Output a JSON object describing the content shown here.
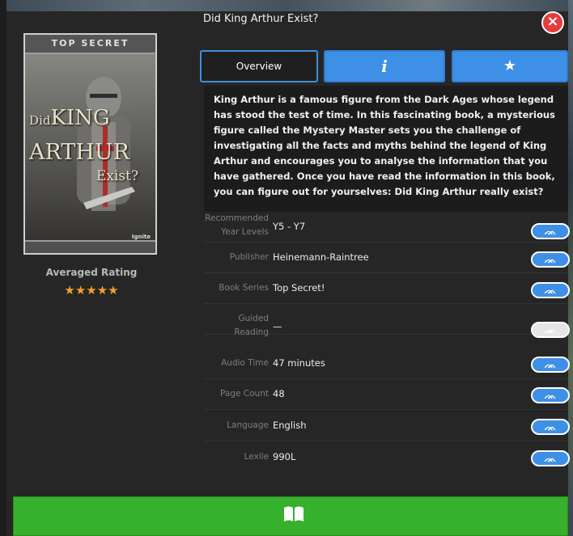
{
  "book": {
    "title": "Did King Arthur Exist?",
    "cover": {
      "series_banner": "TOP SECRET",
      "title_line1_prefix": "Did",
      "title_line1": "KING",
      "title_line2": "ARTHUR",
      "title_line3": "Exist?",
      "publisher_mark": "Ignite"
    },
    "rating_label": "Averaged Rating",
    "rating_stars": 5,
    "stars_text": "★★★★★"
  },
  "tabs": {
    "overview_label": "Overview",
    "info_icon": "i",
    "star_icon": "★"
  },
  "close_icon": "×",
  "description": "King Arthur is a famous figure from the Dark Ages whose legend has stood the test of time. In this fascinating book, a mysterious figure called the Mystery Master sets you the challenge of investigating all the facts and myths behind the legend of King Arthur and encourages you to analyse the information that you have gathered. Once you have read the information in this book, you can figure out for yourselves: Did King Arthur really exist?",
  "metadata": [
    {
      "label_line1": "Recommended",
      "label_line2": "Year Levels",
      "value": "Y5 - Y7",
      "button_enabled": true
    },
    {
      "label_line1": "Publisher",
      "label_line2": "",
      "value": "Heinemann-Raintree",
      "button_enabled": true
    },
    {
      "label_line1": "Book Series",
      "label_line2": "",
      "value": "Top Secret!",
      "button_enabled": true
    },
    {
      "label_line1": "Guided",
      "label_line2": "Reading",
      "value": "—",
      "button_enabled": false
    },
    {
      "label_line1": "Audio Time",
      "label_line2": "",
      "value": "47 minutes",
      "button_enabled": true
    },
    {
      "label_line1": "Page Count",
      "label_line2": "",
      "value": "48",
      "button_enabled": true
    },
    {
      "label_line1": "Language",
      "label_line2": "",
      "value": "English",
      "button_enabled": true
    },
    {
      "label_line1": "Lexile",
      "label_line2": "",
      "value": "990L",
      "button_enabled": true
    }
  ],
  "related_icon": "ᨏ",
  "open_book_icon": "open-book-icon",
  "colors": {
    "accent_blue": "#3d90e6",
    "open_green": "#37b02c",
    "star_orange": "#f1a02a",
    "close_red": "#e83b3b"
  }
}
